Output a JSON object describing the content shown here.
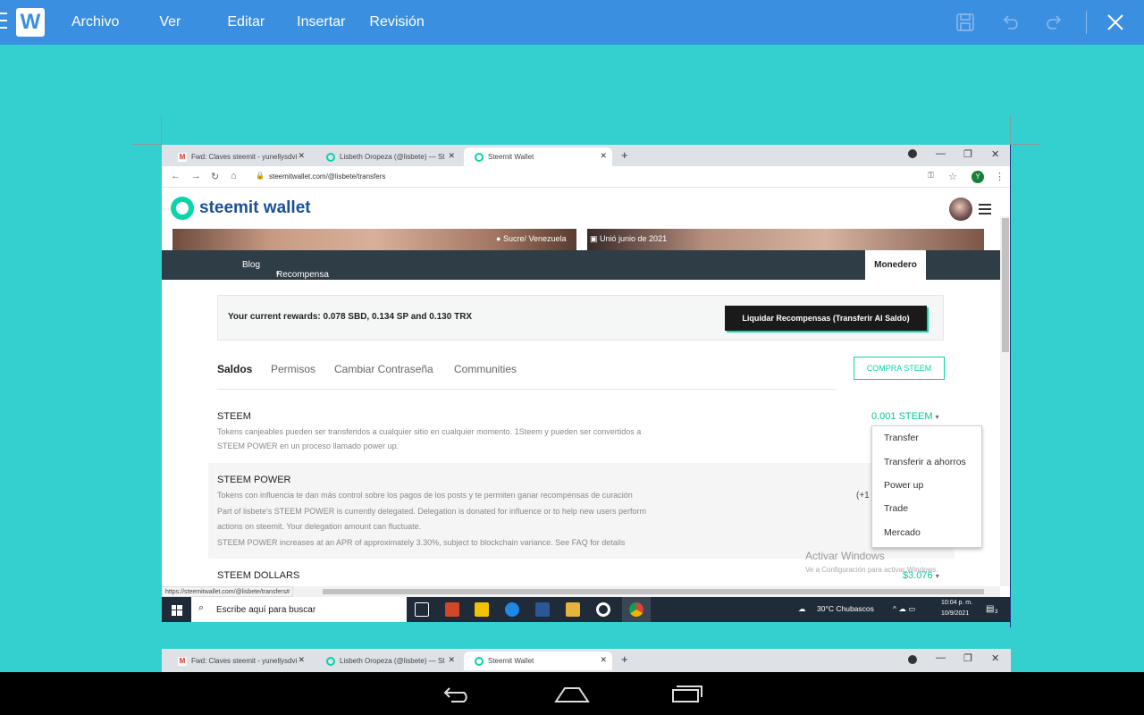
{
  "wps": {
    "logo": "W",
    "menu": [
      "Archivo",
      "Ver",
      "Editar",
      "Insertar",
      "Revisión"
    ],
    "icons": [
      "save-icon",
      "undo-icon",
      "redo-icon",
      "close-icon"
    ]
  },
  "browser": {
    "tabs": [
      {
        "label": "Fwd: Claves steemit - yunellysdvi",
        "icon": "gmail-icon"
      },
      {
        "label": "Lisbeth Oropeza (@lisbete) — St",
        "icon": "steemit-icon"
      },
      {
        "label": "Steemit Wallet",
        "icon": "steemit-icon"
      }
    ],
    "new_tab": "+",
    "url": "steemitwallet.com/@lisbete/transfers",
    "profile_letter": "Y",
    "status_url": "https://steemitwallet.com/@lisbete/transfers#"
  },
  "wallet": {
    "logo_text": "steemit wallet",
    "location": "Sucre/ Venezuela",
    "joined": "Unió junio de 2021",
    "nav": {
      "blog": "Blog",
      "rewards": "Recompensa",
      "wallet": "Monedero"
    },
    "rewards_text": "Your current rewards: 0.078 SBD, 0.134 SP and 0.130 TRX",
    "claim_button": "Liquidar Recompensas (Transferir Al Saldo)",
    "tabs": [
      "Saldos",
      "Permisos",
      "Cambiar Contraseña",
      "Communities"
    ],
    "buy_button": "COMPRA STEEM",
    "steem": {
      "title": "STEEM",
      "desc1": "Tokens canjeables pueden ser transferidos a cualquier sitio en cualquier momento. 1Steem y pueden ser convertidos a",
      "desc2": "STEEM POWER en un proceso llamado power up.",
      "amount": "0.001 STEEM"
    },
    "steem_power": {
      "title": "STEEM POWER",
      "line1": "Tokens con influencia te dan más control sobre los pagos de los posts y te permiten ganar recompensas de curación",
      "line2": "Part of lisbete's STEEM POWER is currently delegated. Delegation is donated for influence or to help new users perform",
      "line3": "actions on steemit. Your delegation amount can fluctuate.",
      "line4": "STEEM POWER increases at an APR of approximately 3.30%, subject to blockchain variance. See FAQ for details",
      "delegated_partial": "(+1"
    },
    "steem_dollars": {
      "title": "STEEM DOLLARS",
      "amount": "$3.076"
    },
    "dropdown": [
      "Transfer",
      "Transferir a ahorros",
      "Power up",
      "Trade",
      "Mercado"
    ]
  },
  "windows": {
    "activate_title": "Activar Windows",
    "activate_sub": "Ve a Configuración para activar Windows.",
    "search_placeholder": "Escribe aquí para buscar",
    "weather": "30°C  Chubascos",
    "time": "10:04 p. m.",
    "date": "10/9/2021",
    "notif_count": "3"
  }
}
